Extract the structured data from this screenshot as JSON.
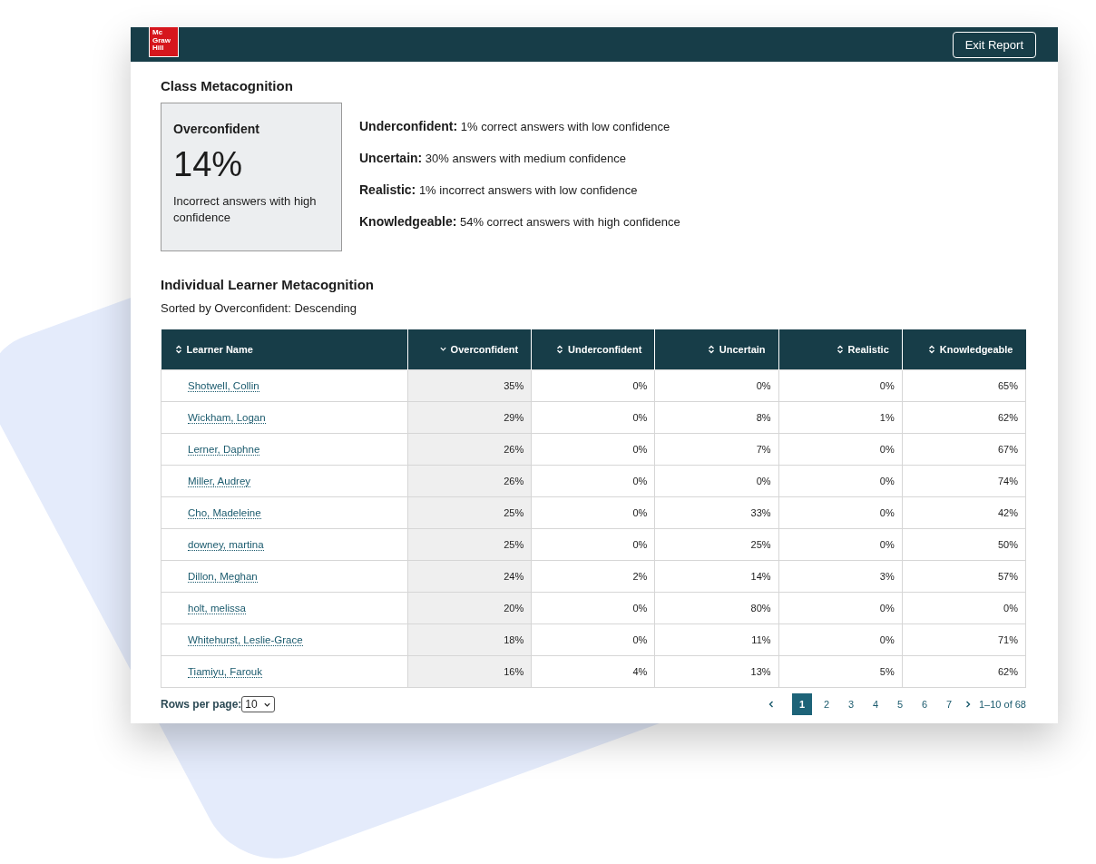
{
  "header": {
    "logo": [
      "Mc",
      "Graw",
      "Hill"
    ],
    "exit_button": "Exit Report"
  },
  "class_metacognition": {
    "title": "Class Metacognition",
    "highlight": {
      "label": "Overconfident",
      "value": "14%",
      "description": "Incorrect answers with high confidence"
    },
    "items": [
      {
        "label": "Underconfident:",
        "text": "1% correct answers with low confidence"
      },
      {
        "label": "Uncertain:",
        "text": "30% answers with medium confidence"
      },
      {
        "label": "Realistic:",
        "text": "1% incorrect answers with low confidence"
      },
      {
        "label": "Knowledgeable:",
        "text": "54% correct answers with high confidence"
      }
    ]
  },
  "individual": {
    "title": "Individual Learner Metacognition",
    "sort_note": "Sorted by Overconfident: Descending",
    "table": {
      "columns": [
        {
          "label": "Learner Name",
          "sorted": false
        },
        {
          "label": "Overconfident",
          "sorted": true
        },
        {
          "label": "Underconfident",
          "sorted": false
        },
        {
          "label": "Uncertain",
          "sorted": false
        },
        {
          "label": "Realistic",
          "sorted": false
        },
        {
          "label": "Knowledgeable",
          "sorted": false
        }
      ],
      "rows": [
        [
          "Shotwell, Collin",
          "35%",
          "0%",
          "0%",
          "0%",
          "65%"
        ],
        [
          "Wickham, Logan",
          "29%",
          "0%",
          "8%",
          "1%",
          "62%"
        ],
        [
          "Lerner, Daphne",
          "26%",
          "0%",
          "7%",
          "0%",
          "67%"
        ],
        [
          "Miller, Audrey",
          "26%",
          "0%",
          "0%",
          "0%",
          "74%"
        ],
        [
          "Cho, Madeleine",
          "25%",
          "0%",
          "33%",
          "0%",
          "42%"
        ],
        [
          "downey, martina",
          "25%",
          "0%",
          "25%",
          "0%",
          "50%"
        ],
        [
          "Dillon, Meghan",
          "24%",
          "2%",
          "14%",
          "3%",
          "57%"
        ],
        [
          "holt, melissa",
          "20%",
          "0%",
          "80%",
          "0%",
          "0%"
        ],
        [
          "Whitehurst, Leslie-Grace",
          "18%",
          "0%",
          "11%",
          "0%",
          "71%"
        ],
        [
          "Tiamiyu, Farouk",
          "16%",
          "4%",
          "13%",
          "5%",
          "62%"
        ]
      ]
    },
    "rows_per_page": {
      "label": "Rows per page:",
      "value": "10"
    },
    "pagination": {
      "pages": [
        {
          "label": "1",
          "selected": true
        },
        {
          "label": "2",
          "selected": false
        },
        {
          "label": "3",
          "selected": false
        },
        {
          "label": "4",
          "selected": false
        },
        {
          "label": "5",
          "selected": false
        },
        {
          "label": "6",
          "selected": false
        },
        {
          "label": "7",
          "selected": false
        }
      ],
      "range": "1–10 of 68"
    }
  }
}
